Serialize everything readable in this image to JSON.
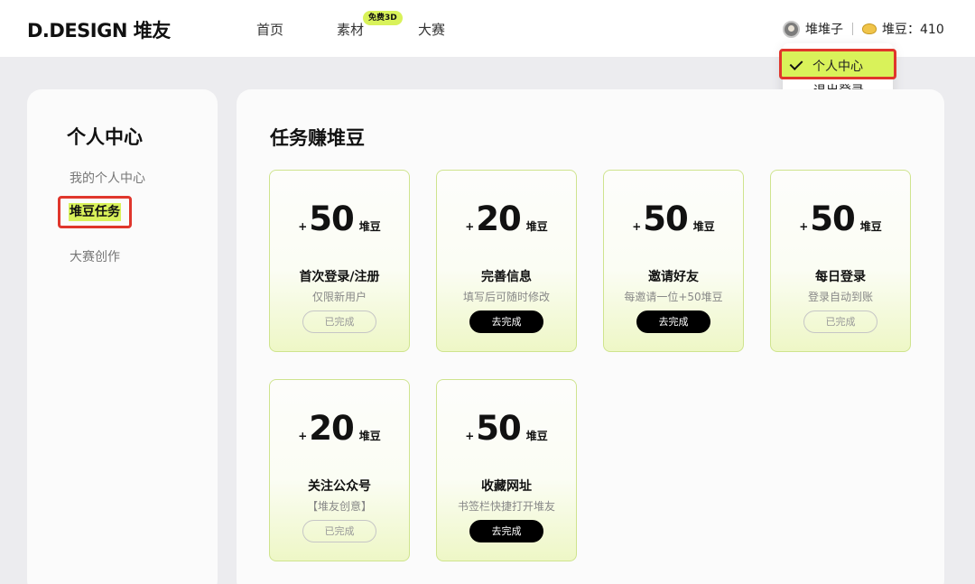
{
  "header": {
    "logo": "D.DESIGN 堆友",
    "nav": [
      "首页",
      "素材",
      "大赛"
    ],
    "nav_badge": "免费3D",
    "user_name": "堆堆子",
    "beans_label": "堆豆：410"
  },
  "dropdown": {
    "items": [
      "个人中心",
      "退出登录"
    ]
  },
  "sidebar": {
    "title": "个人中心",
    "items": [
      "我的个人中心",
      "堆豆任务",
      "大赛创作"
    ]
  },
  "main": {
    "title": "任务赚堆豆",
    "bean_unit": "堆豆",
    "plus_sign": "+",
    "tasks": [
      {
        "amount": "50",
        "name": "首次登录/注册",
        "desc": "仅限新用户",
        "button": "已完成"
      },
      {
        "amount": "20",
        "name": "完善信息",
        "desc": "填写后可随时修改",
        "button": "去完成"
      },
      {
        "amount": "50",
        "name": "邀请好友",
        "desc": "每邀请一位+50堆豆",
        "button": "去完成"
      },
      {
        "amount": "50",
        "name": "每日登录",
        "desc": "登录自动到账",
        "button": "已完成"
      },
      {
        "amount": "20",
        "name": "关注公众号",
        "desc": "【堆友创意】",
        "button": "已完成"
      },
      {
        "amount": "50",
        "name": "收藏网址",
        "desc": "书签栏快捷打开堆友",
        "button": "去完成"
      }
    ]
  },
  "colors": {
    "accent": "#d9f25a",
    "highlight_border": "#e0362c"
  }
}
